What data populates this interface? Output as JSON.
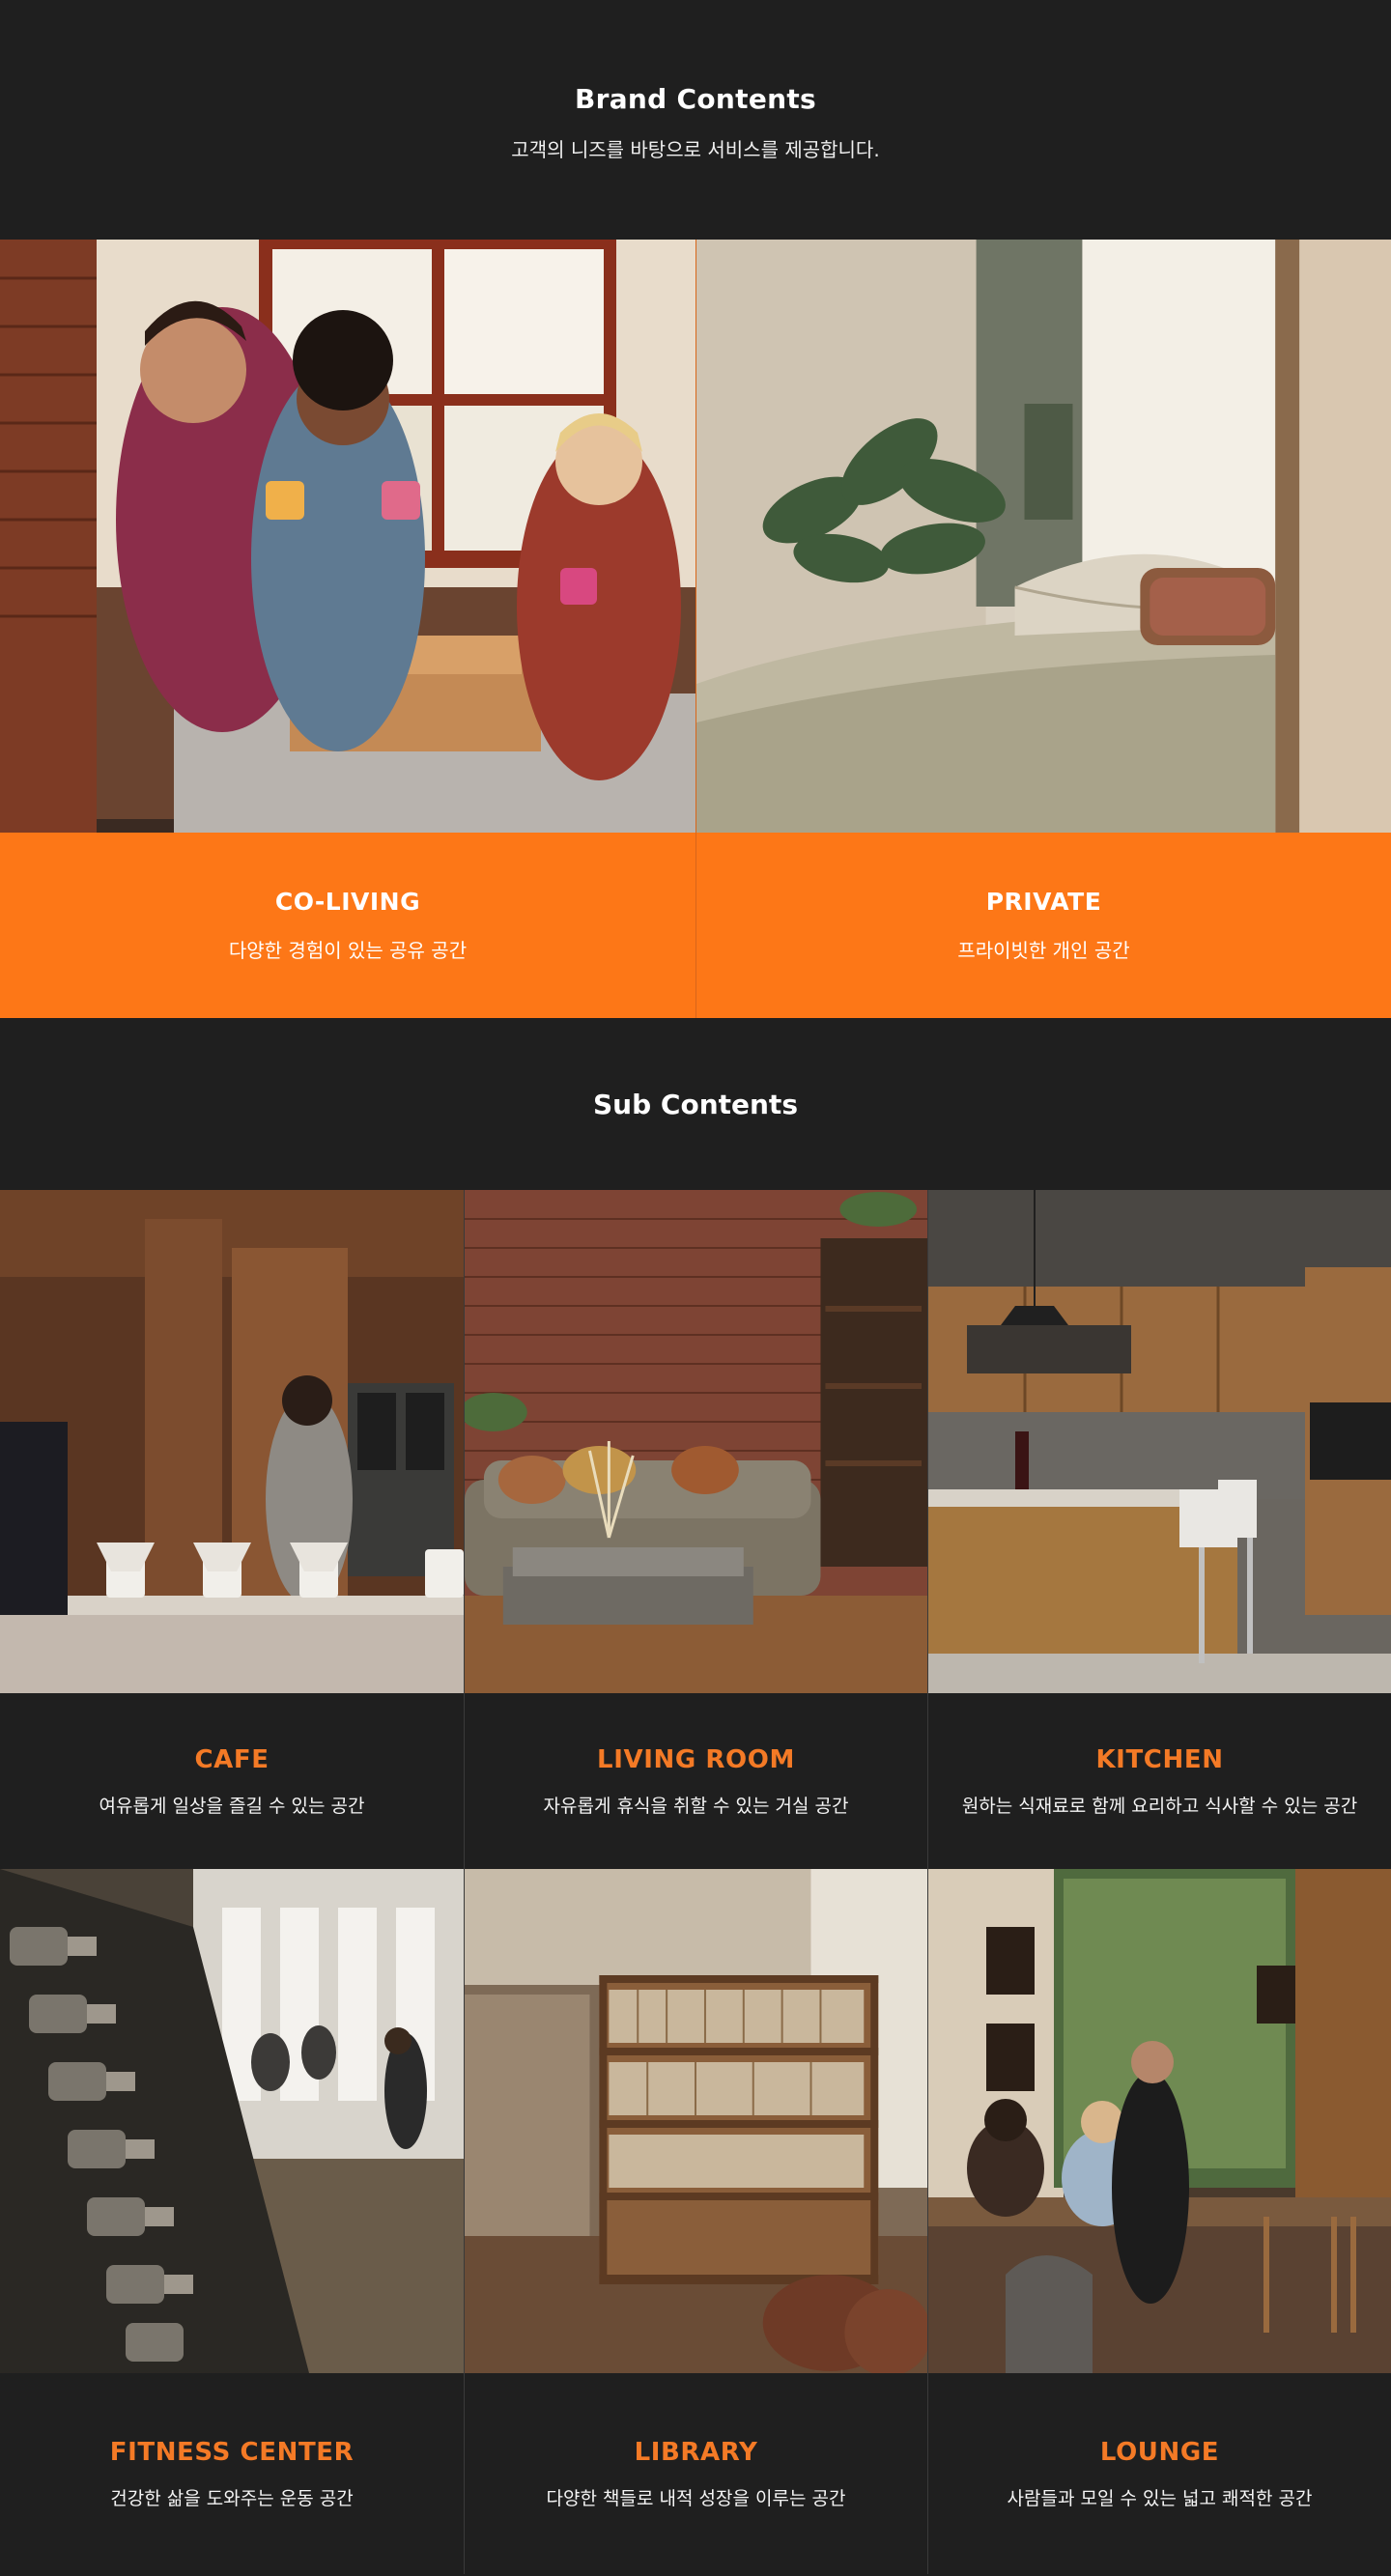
{
  "brand": {
    "title": "Brand Contents",
    "subtitle": "고객의 니즈를 바탕으로 서비스를 제공합니다.",
    "cards": [
      {
        "title": "CO-LIVING",
        "desc": "다양한 경험이 있는 공유 공간"
      },
      {
        "title": "PRIVATE",
        "desc": "프라이빗한 개인 공간"
      }
    ]
  },
  "sub": {
    "title": "Sub Contents",
    "cards": [
      {
        "title": "CAFE",
        "desc": "여유롭게 일상을 즐길 수 있는 공간"
      },
      {
        "title": "LIVING ROOM",
        "desc": "자유롭게 휴식을 취할 수 있는 거실 공간"
      },
      {
        "title": "KITCHEN",
        "desc": "원하는 식재료로 함께 요리하고 식사할 수 있는 공간"
      },
      {
        "title": "FITNESS CENTER",
        "desc": "건강한 삶을 도와주는 운동 공간"
      },
      {
        "title": "LIBRARY",
        "desc": "다양한 책들로 내적 성장을 이루는 공간"
      },
      {
        "title": "LOUNGE",
        "desc": "사람들과 모일 수 있는 넓고 쾌적한 공간"
      }
    ]
  },
  "colors": {
    "background": "#1f1f1f",
    "brand_accent": "#fd7717",
    "sub_title_accent": "#f47a26"
  }
}
